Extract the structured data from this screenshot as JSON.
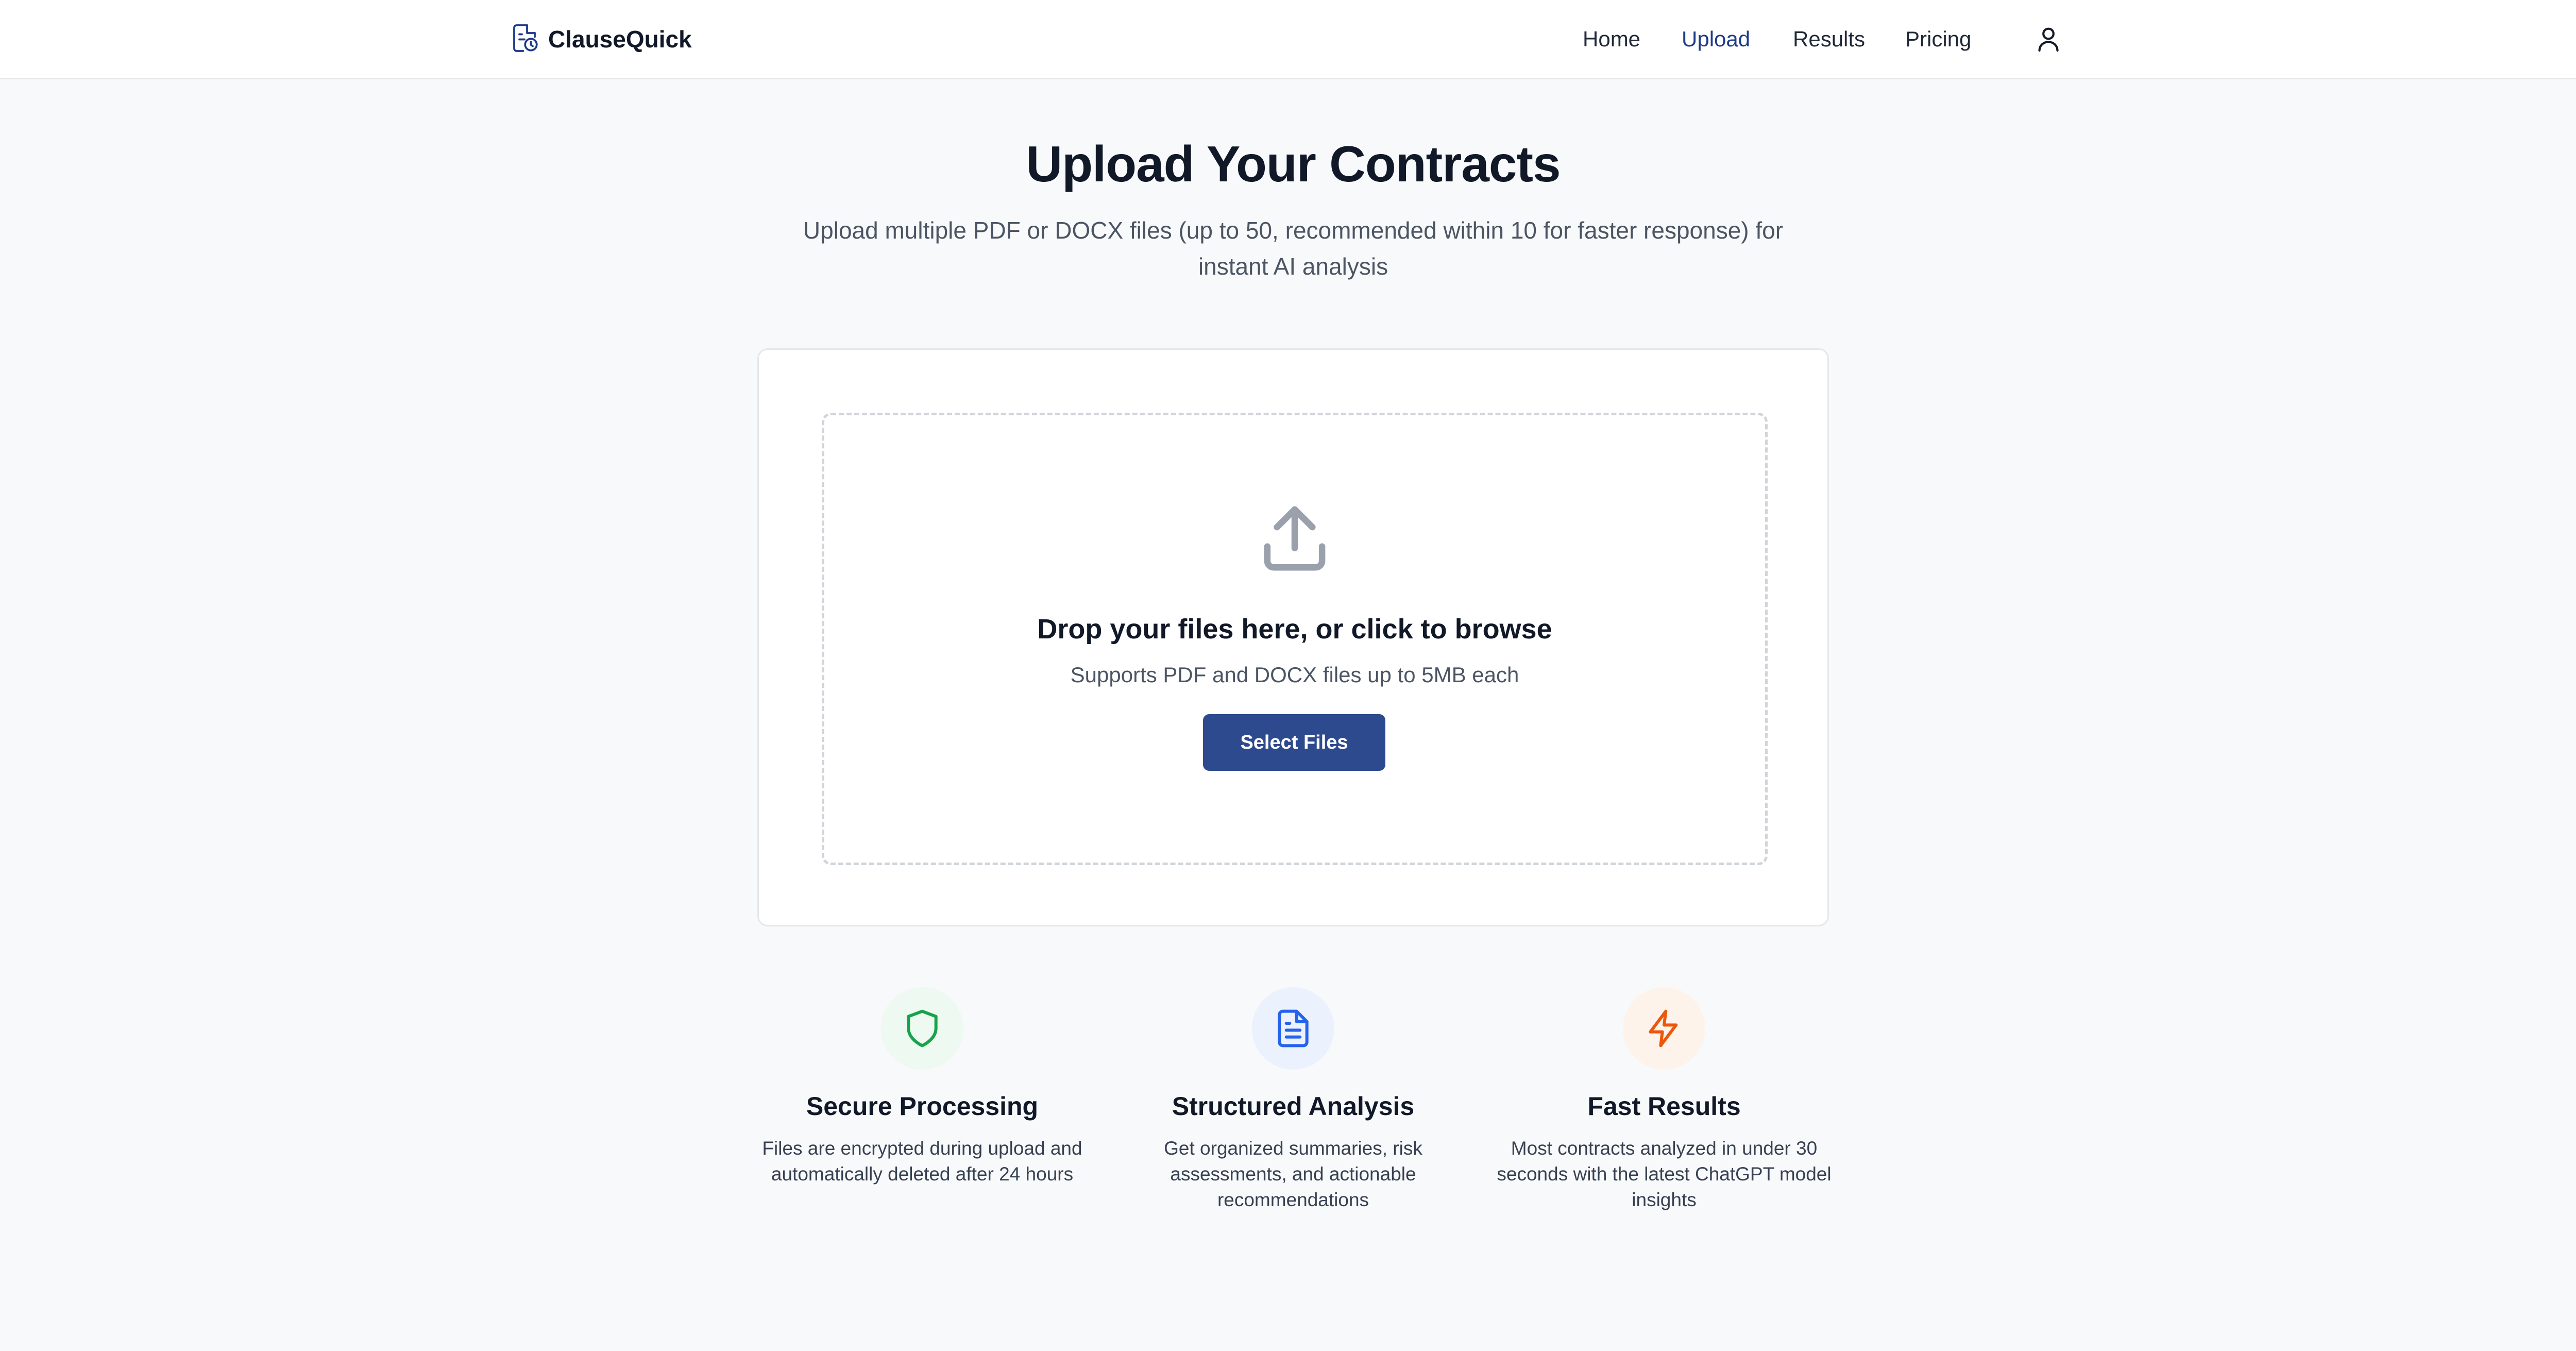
{
  "header": {
    "brand": "ClauseQuick",
    "nav": [
      {
        "label": "Home"
      },
      {
        "label": "Upload",
        "active": true
      },
      {
        "label": "Results"
      },
      {
        "label": "Pricing"
      }
    ],
    "user_icon": "user-icon"
  },
  "hero": {
    "title": "Upload Your Contracts",
    "subtitle": "Upload multiple PDF or DOCX files (up to 50, recommended within 10 for faster response) for instant AI analysis"
  },
  "upload": {
    "icon": "upload-icon",
    "heading": "Drop your files here, or click to browse",
    "subtext": "Supports PDF and DOCX files up to 5MB each",
    "button_label": "Select Files"
  },
  "features": [
    {
      "icon": "shield-icon",
      "title": "Secure Processing",
      "description": "Files are encrypted during upload and automatically deleted after 24 hours",
      "color": "#16a34a",
      "bg": "#edf9f1"
    },
    {
      "icon": "document-icon",
      "title": "Structured Analysis",
      "description": "Get organized summaries, risk assessments, and actionable recommendations",
      "color": "#2563eb",
      "bg": "#ecf2fd"
    },
    {
      "icon": "lightning-icon",
      "title": "Fast Results",
      "description": "Most contracts analyzed in under 30 seconds with the latest ChatGPT model insights",
      "color": "#ea580c",
      "bg": "#fdf3eb"
    }
  ],
  "colors": {
    "accent": "#2e4a8e",
    "nav_active": "#1e3a8a"
  }
}
